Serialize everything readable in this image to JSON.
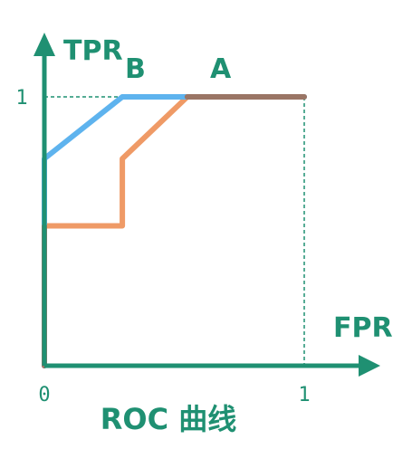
{
  "chart_data": {
    "type": "line",
    "title": "ROC 曲线",
    "xlabel": "FPR",
    "ylabel": "TPR",
    "xlim": [
      0,
      1
    ],
    "ylim": [
      0,
      1
    ],
    "xticks": [
      "0",
      "1"
    ],
    "yticks": [
      "1"
    ],
    "series": [
      {
        "name": "A",
        "color": "#ef9a66",
        "x": [
          0,
          0,
          0.3,
          0.3,
          0.55,
          1
        ],
        "y": [
          0,
          0.52,
          0.52,
          0.77,
          1,
          1
        ]
      },
      {
        "name": "B",
        "color": "#5eb3ee",
        "x": [
          0,
          0,
          0.3,
          1
        ],
        "y": [
          0,
          0.77,
          1,
          1
        ]
      }
    ],
    "colors": {
      "axis": "#1f9072",
      "overlap": "#9a7565"
    }
  }
}
